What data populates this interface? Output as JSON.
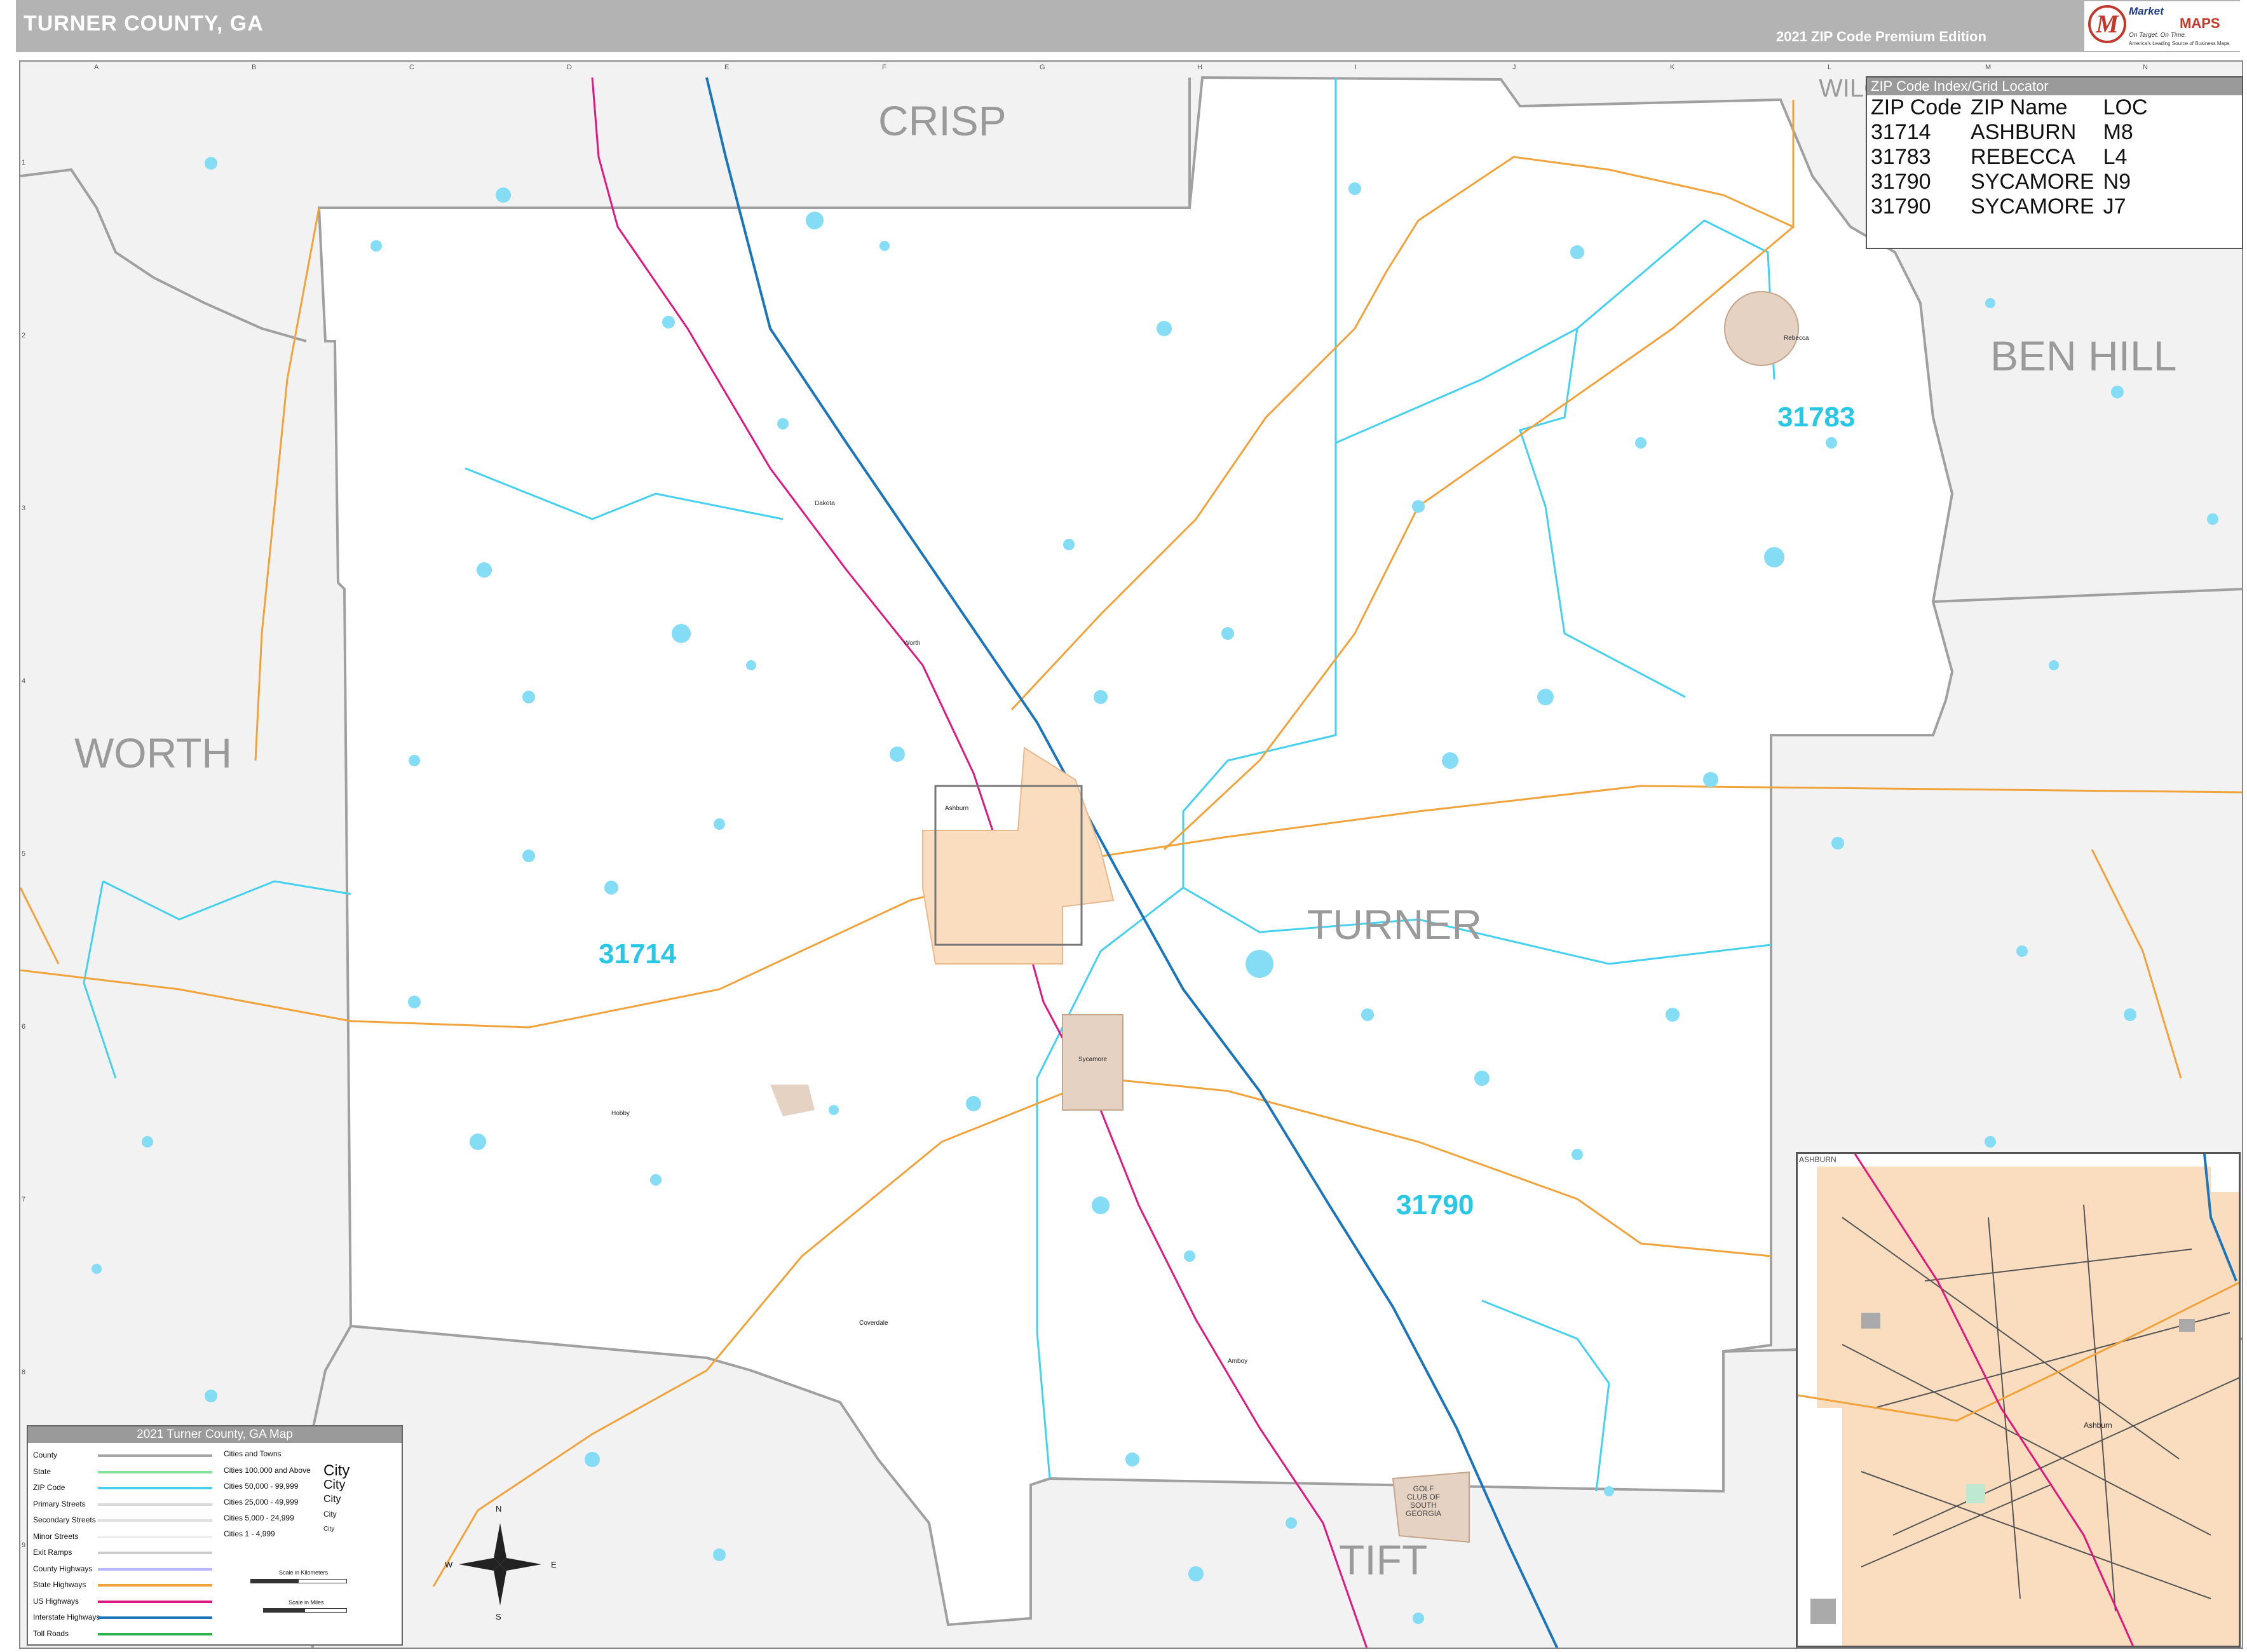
{
  "header": {
    "title": "TURNER COUNTY, GA",
    "edition": "2021 ZIP Code Premium Edition",
    "logo_word": "Market",
    "logo_maps": "MAPS",
    "logo_tagline": "On Target. On Time.",
    "logo_tagline2": "America's Leading Source of Business Maps",
    "logo_letter": "M"
  },
  "counties": {
    "crisp": "CRISP",
    "wilcox": "WILC",
    "ben_hill": "BEN HILL",
    "worth": "WORTH",
    "turner": "TURNER",
    "tift": "TIFT"
  },
  "zip_labels": {
    "z31783": "31783",
    "z31714": "31714",
    "z31790": "31790"
  },
  "zip_index": {
    "title": "ZIP Code Index/Grid Locator",
    "headers": [
      "ZIP Code",
      "ZIP Name",
      "LOC"
    ],
    "rows": [
      [
        "31714",
        "ASHBURN",
        "M8"
      ],
      [
        "31783",
        "REBECCA",
        "L4"
      ],
      [
        "31790",
        "SYCAMORE",
        "N9"
      ],
      [
        "31790",
        "SYCAMORE",
        "J7"
      ]
    ]
  },
  "grid": {
    "letters": [
      "A",
      "B",
      "C",
      "D",
      "E",
      "F",
      "G",
      "H",
      "I",
      "J",
      "K",
      "L",
      "M",
      "N"
    ],
    "numbers": [
      "1",
      "2",
      "3",
      "4",
      "5",
      "6",
      "7",
      "8",
      "9"
    ]
  },
  "legend": {
    "title": "2021 Turner County, GA Map",
    "items": [
      "County",
      "State",
      "ZIP Code",
      "Primary Streets",
      "Secondary Streets",
      "Minor Streets",
      "Exit Ramps",
      "County Highways",
      "State Highways",
      "US Highways",
      "Interstate Highways",
      "Toll Roads"
    ],
    "cities_title": "Cities and Towns",
    "cities": [
      "Cities 100,000 and Above",
      "Cities 50,000 - 99,999",
      "Cities 25,000 - 49,999",
      "Cities 5,000 - 24,999",
      "Cities 1 - 4,999"
    ],
    "city_samples": [
      "City",
      "City",
      "City",
      "City",
      "City"
    ],
    "scale_km": "Scale in Kilometers",
    "scale_mi": "Scale in Miles",
    "colors": {
      "county": "#a6a6a6",
      "state": "#7fe39a",
      "zip": "#45d1ee",
      "primary": "#d9d9d9",
      "secondary": "#e0e0e0",
      "minor": "#eeeeee",
      "exit": "#cccccc",
      "county_hwy": "#b8b8ff",
      "state_hwy": "#f0a33b",
      "us_hwy": "#e0177e",
      "interstate": "#1b75bb",
      "toll": "#2db34a"
    }
  },
  "compass": {
    "n": "N",
    "s": "S",
    "e": "E",
    "w": "W"
  },
  "places": {
    "rebecca": "Rebecca",
    "sycamore": "Sycamore",
    "ashburn": "Ashburn",
    "dakota": "Dakota",
    "worth_town": "Worth",
    "hobby": "Hobby",
    "coverdale": "Coverdale",
    "amboy": "Amboy"
  },
  "golf": [
    "GOLF",
    "CLUB OF",
    "SOUTH",
    "GEORGIA"
  ],
  "inset": {
    "title": "ASHBURN",
    "place": "Ashburn"
  }
}
